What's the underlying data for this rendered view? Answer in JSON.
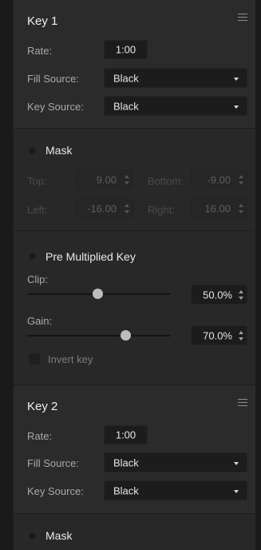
{
  "key1": {
    "title": "Key 1",
    "rate_label": "Rate:",
    "rate_value": "1:00",
    "fill_source_label": "Fill Source:",
    "fill_source_value": "Black",
    "key_source_label": "Key Source:",
    "key_source_value": "Black"
  },
  "mask1": {
    "title": "Mask",
    "top_label": "Top:",
    "top_value": "9.00",
    "bottom_label": "Bottom:",
    "bottom_value": "-9.00",
    "left_label": "Left:",
    "left_value": "-16.00",
    "right_label": "Right:",
    "right_value": "16.00"
  },
  "premultiplied": {
    "title": "Pre Multiplied Key",
    "clip_label": "Clip:",
    "clip_value": "50.0%",
    "clip_fraction": 0.5,
    "gain_label": "Gain:",
    "gain_value": "70.0%",
    "gain_fraction": 0.7,
    "invert_label": "Invert key"
  },
  "key2": {
    "title": "Key 2",
    "rate_label": "Rate:",
    "rate_value": "1:00",
    "fill_source_label": "Fill Source:",
    "fill_source_value": "Black",
    "key_source_label": "Key Source:",
    "key_source_value": "Black"
  },
  "mask2": {
    "title": "Mask"
  },
  "icons": {
    "menu": "hamburger-menu-icon",
    "dropdown": "chevron-down-icon",
    "stepper": "stepper-arrows-icon",
    "indicator": "led-indicator-icon"
  }
}
